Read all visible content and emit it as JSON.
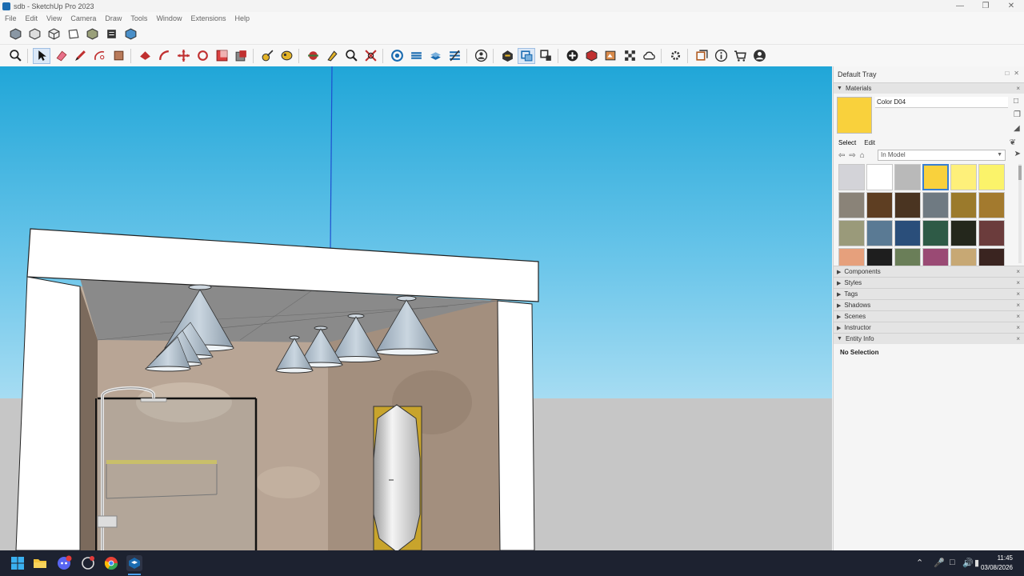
{
  "window": {
    "title": "sdb - SketchUp Pro 2023",
    "controls": [
      "minimize-icon",
      "restore-icon",
      "close-icon"
    ]
  },
  "menu": [
    "File",
    "Edit",
    "View",
    "Camera",
    "Draw",
    "Tools",
    "Window",
    "Extensions",
    "Help"
  ],
  "toolbar_row1": [
    "iso-view-icon",
    "top-view-icon",
    "front-view-icon",
    "right-view-icon",
    "back-view-icon",
    "left-view-icon",
    "bottom-view-icon"
  ],
  "toolbar_row2": [
    "zoom-window-icon",
    "select-icon",
    "eraser-icon",
    "pencil-icon",
    "shapes-icon",
    "push-pull-icon",
    "paint-bucket-icon",
    "follow-me-icon",
    "move-icon",
    "rotate-icon",
    "scale-icon",
    "offset-icon",
    "tape-measure-icon",
    "walk-icon",
    "orbit-icon",
    "look-around-icon",
    "zoom-icon",
    "zoom-extents-icon",
    "section-plane-icon",
    "section-display-icon",
    "section-cuts-icon",
    "section-fill-icon",
    "user-icon",
    "components-icon",
    "select-group-icon",
    "cut-icon",
    "add-icon",
    "solid-tools-icon",
    "photo-texture-icon",
    "checker-icon",
    "cloud-icon",
    "extension-icon",
    "layout-icon",
    "info-icon",
    "cart-icon",
    "account-icon"
  ],
  "tray": {
    "title": "Default Tray",
    "materials": {
      "panel_title": "Materials",
      "material_name": "Color D04",
      "current_color": "#f9d13c",
      "tab_select": "Select",
      "tab_edit": "Edit",
      "collection": "In Model",
      "swatches": [
        "#d3d3d8",
        "#ffffff",
        "#b9b9b9",
        "#f9d13c",
        "#fef07a",
        "#fbf36a",
        "#8a8378",
        "#5e3e22",
        "#4a3421",
        "#6f7a82",
        "#9b7a2c",
        "#a37a2e",
        "#9a9a7a",
        "#5a7a94",
        "#2a4e7a",
        "#2e5a46",
        "#24271c",
        "#6b3c3c",
        "#e6a07c",
        "#1e1e1e",
        "#6a7e58",
        "#9a4a74",
        "#c7a874",
        "#3a2420"
      ],
      "selected_index": 3
    },
    "panels": [
      "Components",
      "Styles",
      "Tags",
      "Shadows",
      "Scenes",
      "Instructor",
      "Entity Info"
    ],
    "entity_info": "No Selection"
  },
  "taskbar": {
    "apps": [
      "windows-start-icon",
      "file-explorer-icon",
      "discord-icon",
      "ai-app-icon",
      "chrome-icon",
      "sketchup-icon"
    ],
    "time": "11:45",
    "date": "03/08/2026"
  }
}
